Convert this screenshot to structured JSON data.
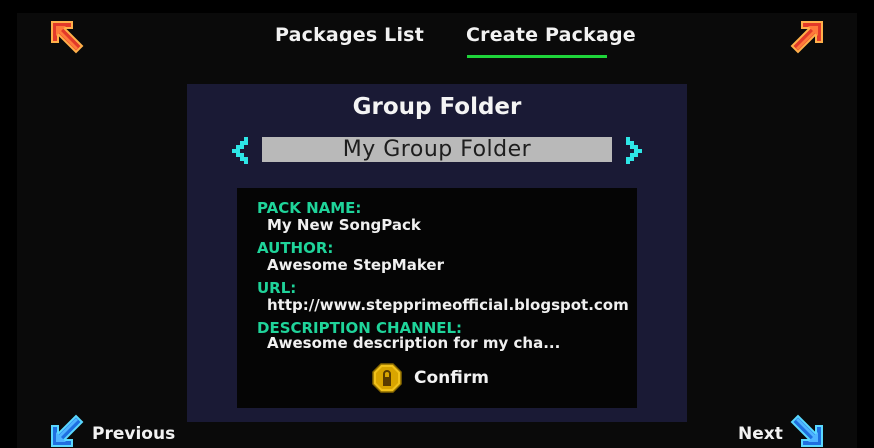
{
  "tabs": [
    {
      "label": "Packages List",
      "active": false
    },
    {
      "label": "Create Package",
      "active": true
    }
  ],
  "accent_color": "#1ed43a",
  "label_color": "#1fd49a",
  "panel": {
    "title": "Group Folder",
    "folder_value": "My Group Folder",
    "fields": [
      {
        "label": "PACK NAME:",
        "value": "My New SongPack"
      },
      {
        "label": "AUTHOR:",
        "value": "Awesome StepMaker"
      },
      {
        "label": "URL:",
        "value": "http://www.stepprimeofficial.blogspot.com"
      },
      {
        "label": "DESCRIPTION CHANNEL:",
        "value": "Awesome description for my cha..."
      }
    ],
    "confirm_label": "Confirm",
    "confirm_icon": "lock-icon"
  },
  "footer": {
    "previous_label": "Previous",
    "next_label": "Next"
  },
  "icons": {
    "top_left": "arrow-up-left-icon",
    "top_right": "arrow-up-right-icon",
    "bottom_left": "arrow-down-left-icon",
    "bottom_right": "arrow-down-right-icon",
    "folder_prev": "chevron-left-icon",
    "folder_next": "chevron-right-icon"
  }
}
